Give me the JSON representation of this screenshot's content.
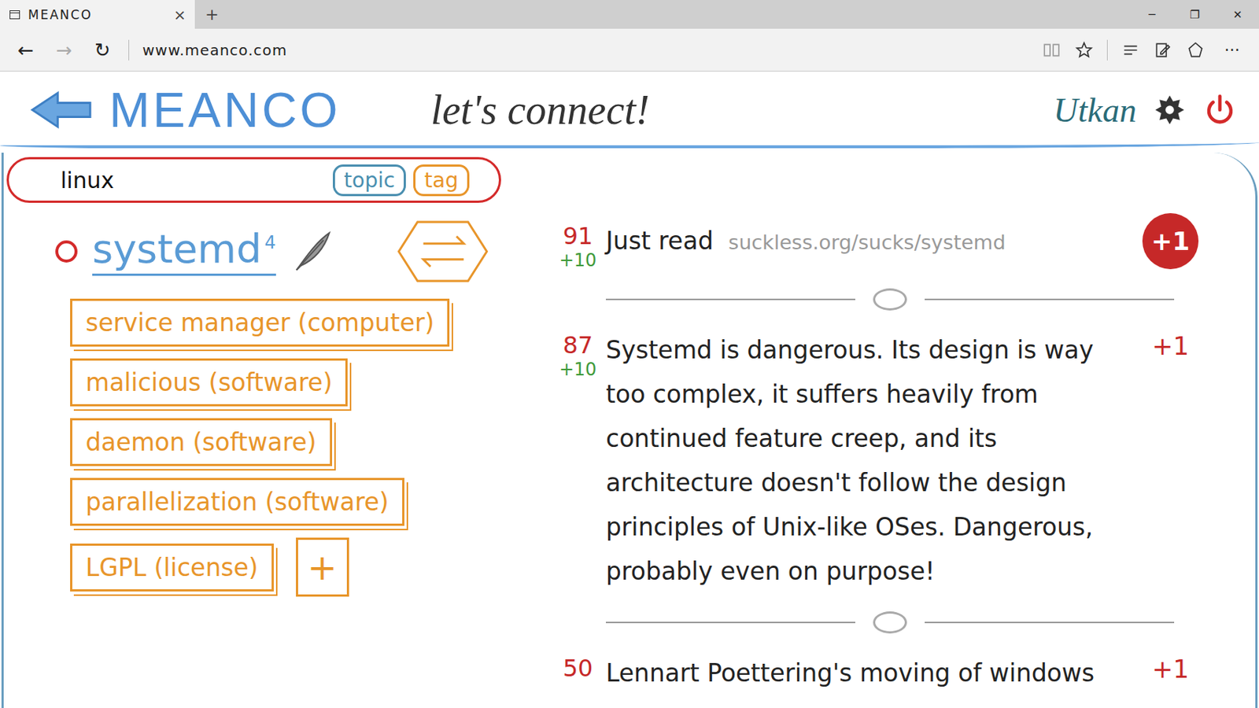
{
  "window": {
    "tab_title": "MEANCO",
    "tab_close": "×",
    "new_tab": "+",
    "controls": [
      "─",
      "❐",
      "✕"
    ]
  },
  "toolbar": {
    "back": "←",
    "forward": "→",
    "refresh": "↻",
    "address": "www.meanco.com",
    "more": "···"
  },
  "header": {
    "logo": "MEANCO",
    "slogan": "let's connect!",
    "user": "Utkan"
  },
  "search": {
    "value": "linux",
    "modes": [
      {
        "label": "topic",
        "selected": false,
        "color": "#4a8fb0"
      },
      {
        "label": "tag",
        "selected": false,
        "color": "#e8952a"
      }
    ]
  },
  "topic": {
    "name": "systemd",
    "count": "4"
  },
  "tags": [
    "service manager (computer)",
    "malicious (software)",
    "daemon (software)",
    "parallelization (software)",
    "LGPL (license)"
  ],
  "add_tag": "+",
  "posts": [
    {
      "score": "91",
      "bonus": "+10",
      "text": "Just read ",
      "link": "suckless.org/sucks/systemd",
      "plus": "+1",
      "highlighted": true
    },
    {
      "score": "87",
      "bonus": "+10",
      "text": "Systemd is dangerous. Its design is way too complex, it suffers heavily from continued feature creep, and its architecture doesn't follow the design principles of Unix-like OSes. Dangerous, probably even on purpose!",
      "link": "",
      "plus": "+1",
      "highlighted": false
    },
    {
      "score": "50",
      "bonus": "",
      "text": "Lennart Poettering's moving of windows",
      "link": "",
      "plus": "+1",
      "highlighted": false
    }
  ]
}
